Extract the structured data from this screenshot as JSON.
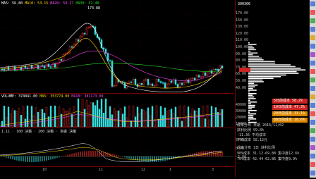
{
  "header": {
    "ma_line": "MA5: 56.80  MA10: 53.15  MA20: 50.17  MA30: 52.40",
    "ma_parts": [
      {
        "text": "MA5: 56.80",
        "color": "#ffffff"
      },
      {
        "text": "MA10: 53.15",
        "color": "#ffdd00"
      },
      {
        "text": "MA20: 50.17",
        "color": "#ff44ff"
      },
      {
        "text": "MA30: 52.40",
        "color": "#22dd22"
      }
    ],
    "vol_line": "VOLUME: 374041.00  MA5: 353774.00  MA10: 381173.00",
    "vol_parts": [
      {
        "text": "VOLUME: 374041.00",
        "color": "#ffffff"
      },
      {
        "text": "MA5: 353774.00",
        "color": "#ffdd00"
      },
      {
        "text": "MA10: 381173.00",
        "color": "#ff44ff"
      }
    ],
    "macd_line": "1.11  ·  100 決策  ·  200 決策  ·  資金 決策",
    "high_label": "173.88"
  },
  "price_axis": [
    "170.00",
    "160.00",
    "130.00",
    "120.00",
    "110.00",
    "100.00",
    "90.00",
    "80.00",
    "70.00",
    "60.00",
    "50.00",
    "40.00"
  ],
  "vol_axis": [
    "40000",
    "30000",
    "20000",
    "10000"
  ],
  "macd_axis": [
    "5.00",
    "0.00",
    "-5.00"
  ],
  "date_axis": [
    "10",
    "11",
    "12",
    "1",
    "3"
  ],
  "side": {
    "code": "300306",
    "info_rows": [
      "成本分布  1日  获利比例",
      "90%成本 31.12-69.88  集中度12.6%",
      "70%成本 42.44-62.86  集中度9.9%"
    ],
    "cost_rows": [
      {
        "label": "5日前成本 58.2%",
        "color": "#cc2222"
      },
      {
        "label": "10日前成本 47.3%",
        "color": "#cc2222"
      },
      {
        "label": "20日前成本 33.1%",
        "color": "#dd8800"
      },
      {
        "label": "60日前成本 18.6%",
        "color": "#dd8800"
      }
    ],
    "bottom_rows": [
      "成本分布 日期 2016/11/02",
      "获利比例 99.8%",
      "-11.36 平均成本",
      "平均成本 58.12元"
    ]
  }
}
